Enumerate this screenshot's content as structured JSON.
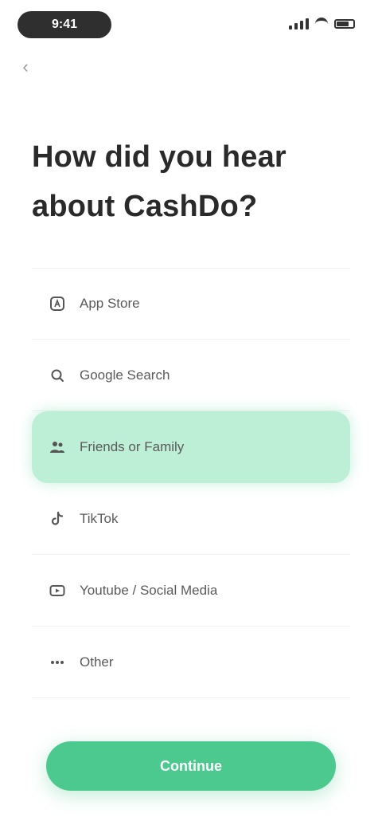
{
  "status_bar": {
    "time": "9:41"
  },
  "question": {
    "title": "How did you hear about CashDo?"
  },
  "options": [
    {
      "label": "App Store",
      "icon": "app-store-icon",
      "selected": false
    },
    {
      "label": "Google Search",
      "icon": "search-icon",
      "selected": false
    },
    {
      "label": "Friends or Family",
      "icon": "friends-icon",
      "selected": true
    },
    {
      "label": "TikTok",
      "icon": "tiktok-icon",
      "selected": false
    },
    {
      "label": "Youtube / Social Media",
      "icon": "youtube-icon",
      "selected": false
    },
    {
      "label": "Other",
      "icon": "other-icon",
      "selected": false
    }
  ],
  "footer": {
    "continue_label": "Continue"
  },
  "colors": {
    "accent": "#4cc98e",
    "selected_bg": "#bdeed6"
  }
}
